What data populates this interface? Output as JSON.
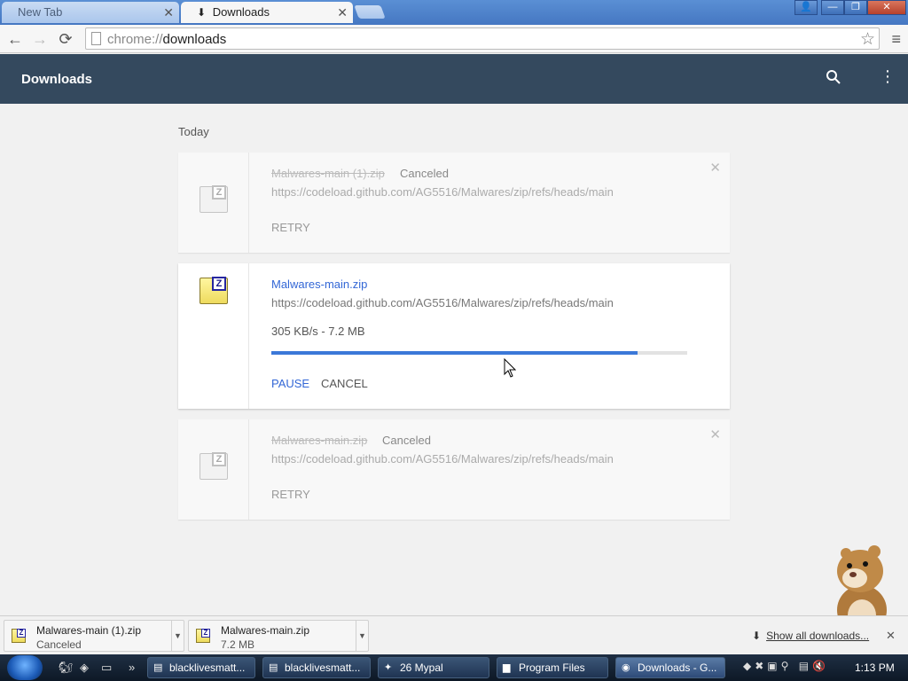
{
  "window": {
    "tabs": [
      {
        "label": "New Tab",
        "active": false
      },
      {
        "label": "Downloads",
        "active": true
      }
    ],
    "controls": {
      "user": "👤",
      "minimize": "—",
      "maximize": "❐",
      "close": "✕"
    }
  },
  "toolbar": {
    "url_scheme": "chrome://",
    "url_path": "downloads",
    "back": "←",
    "forward": "→",
    "reload": "⟳",
    "star": "☆",
    "menu": "≡"
  },
  "header": {
    "title": "Downloads",
    "search_glyph": "🔍",
    "more_glyph": "⋮"
  },
  "section_label": "Today",
  "downloads": [
    {
      "name": "Malwares-main (1).zip",
      "status": "Canceled",
      "url": "https://codeload.github.com/AG5516/Malwares/zip/refs/heads/main",
      "action": "RETRY",
      "state": "canceled"
    },
    {
      "name": "Malwares-main.zip",
      "status": "",
      "url": "https://codeload.github.com/AG5516/Malwares/zip/refs/heads/main",
      "speed": "305 KB/s - 7.2 MB",
      "progress": 0.88,
      "action_primary": "PAUSE",
      "action_secondary": "CANCEL",
      "state": "in_progress"
    },
    {
      "name": "Malwares-main.zip",
      "status": "Canceled",
      "url": "https://codeload.github.com/AG5516/Malwares/zip/refs/heads/main",
      "action": "RETRY",
      "state": "canceled"
    }
  ],
  "shelf": {
    "items": [
      {
        "name": "Malwares-main (1).zip",
        "sub": "Canceled"
      },
      {
        "name": "Malwares-main.zip",
        "sub": "7.2 MB"
      }
    ],
    "show_all": "Show all downloads...",
    "close": "✕"
  },
  "taskbar": {
    "quick_launch_more": "»",
    "tasks": [
      {
        "label": "blacklivesmatt...",
        "active": false
      },
      {
        "label": "blacklivesmatt...",
        "active": false
      },
      {
        "label": "26 Mypal",
        "active": false
      },
      {
        "label": "Program Files",
        "active": false
      },
      {
        "label": "Downloads - G...",
        "active": true
      }
    ],
    "clock": "1:13 PM"
  },
  "colors": {
    "header_bg": "#34495e",
    "link_blue": "#3367d6",
    "progress_fill": "#3b78d8"
  }
}
